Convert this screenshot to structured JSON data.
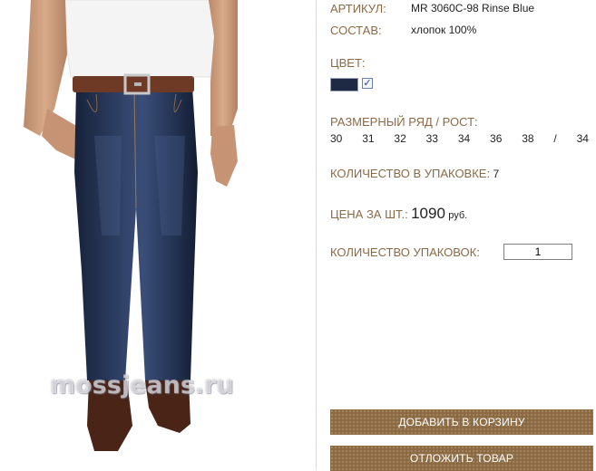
{
  "product": {
    "watermark": "mossjeans.ru",
    "article_label": "АРТИКУЛ:",
    "article_value": "MR 3060C-98 Rinse Blue",
    "composition_label": "СОСТАВ:",
    "composition_value": "хлопок 100%",
    "color_label": "ЦВЕТ:",
    "color_swatch": "#1e2a44",
    "color_checked": "✓",
    "size_label": "РАЗМЕРНЫЙ РЯД / РОСТ:",
    "sizes": [
      "30",
      "31",
      "32",
      "33",
      "34",
      "36",
      "38",
      "/",
      "34"
    ],
    "pack_qty_label": "КОЛИЧЕСТВО В УПАКОВКЕ:",
    "pack_qty_value": "7",
    "price_label": "ЦЕНА ЗА ШТ.:",
    "price_value": "1090",
    "price_currency": "руб.",
    "packs_label": "КОЛИЧЕСТВО УПАКОВОК:",
    "packs_value": "1",
    "add_to_cart": "ДОБАВИТЬ В КОРЗИНУ",
    "postpone": "ОТЛОЖИТЬ ТОВАР"
  },
  "colors": {
    "label": "#8a6a45",
    "button": "#8c6a42",
    "denim": "#1e2a44"
  }
}
